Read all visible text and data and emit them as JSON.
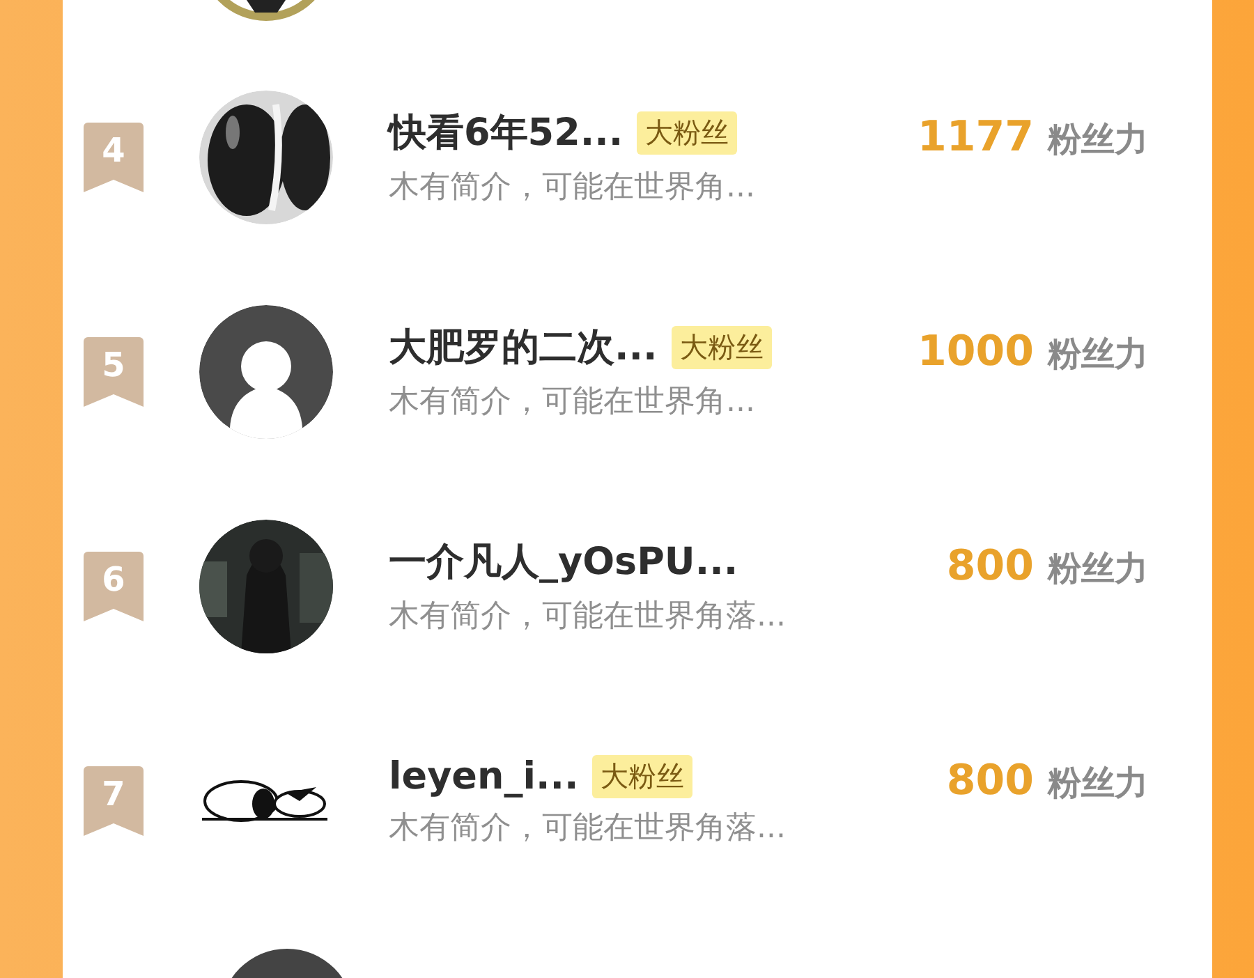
{
  "rows": [
    {
      "rank": "4",
      "name": "快看6年52...",
      "badge": "大粉丝",
      "bio": "木有简介，可能在世界角...",
      "score": "1177",
      "score_unit": "粉丝力"
    },
    {
      "rank": "5",
      "name": "大肥罗的二次...",
      "badge": "大粉丝",
      "bio": "木有简介，可能在世界角...",
      "score": "1000",
      "score_unit": "粉丝力"
    },
    {
      "rank": "6",
      "name": "一介凡人_yOsPU...",
      "bio": "木有简介，可能在世界角落...",
      "score": "800",
      "score_unit": "粉丝力"
    },
    {
      "rank": "7",
      "name": "leyen_i...",
      "badge": "大粉丝",
      "bio": "木有简介，可能在世界角落...",
      "score": "800",
      "score_unit": "粉丝力"
    }
  ]
}
